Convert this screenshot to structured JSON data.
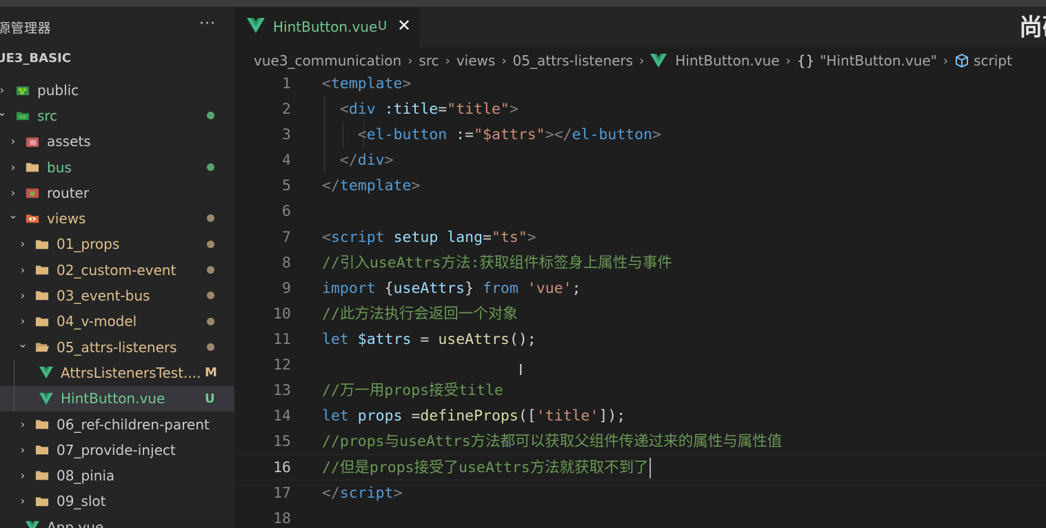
{
  "explorer": {
    "title": "源管理器",
    "more": "···",
    "project": "UE3_BASIC",
    "items": [
      {
        "label": "public",
        "chevron": "›",
        "icon": "public-folder-icon",
        "color": "#cccccc",
        "status": ""
      },
      {
        "label": "src",
        "chevron": "⌄",
        "icon": "src-folder-icon",
        "color": "#73c991",
        "status": "dot"
      },
      {
        "label": "assets",
        "chevron": "›",
        "icon": "assets-folder-icon",
        "color": "#cccccc",
        "status": ""
      },
      {
        "label": "bus",
        "chevron": "›",
        "icon": "folder-icon",
        "color": "#73c991",
        "status": "dot"
      },
      {
        "label": "router",
        "chevron": "›",
        "icon": "router-folder-icon",
        "color": "#cccccc",
        "status": ""
      },
      {
        "label": "views",
        "chevron": "⌄",
        "icon": "views-folder-icon",
        "color": "#e2c08d",
        "status": "dot"
      },
      {
        "label": "01_props",
        "chevron": "›",
        "icon": "folder-icon",
        "color": "#e2c08d",
        "status": "dot"
      },
      {
        "label": "02_custom-event",
        "chevron": "›",
        "icon": "folder-icon",
        "color": "#e2c08d",
        "status": "dot"
      },
      {
        "label": "03_event-bus",
        "chevron": "›",
        "icon": "folder-icon",
        "color": "#e2c08d",
        "status": "dot"
      },
      {
        "label": "04_v-model",
        "chevron": "›",
        "icon": "folder-icon",
        "color": "#e2c08d",
        "status": "dot"
      },
      {
        "label": "05_attrs-listeners",
        "chevron": "⌄",
        "icon": "open-folder-icon",
        "color": "#e2c08d",
        "status": "dot"
      },
      {
        "label": "AttrsListenersTest....",
        "chevron": "",
        "icon": "vue-file-icon",
        "color": "#e2c08d",
        "status": "M"
      },
      {
        "label": "HintButton.vue",
        "chevron": "",
        "icon": "vue-file-icon",
        "color": "#73c991",
        "status": "U"
      },
      {
        "label": "06_ref-children-parent",
        "chevron": "›",
        "icon": "folder-icon",
        "color": "#cccccc",
        "status": ""
      },
      {
        "label": "07_provide-inject",
        "chevron": "›",
        "icon": "folder-icon",
        "color": "#cccccc",
        "status": ""
      },
      {
        "label": "08_pinia",
        "chevron": "›",
        "icon": "folder-icon",
        "color": "#cccccc",
        "status": ""
      },
      {
        "label": "09_slot",
        "chevron": "›",
        "icon": "folder-icon",
        "color": "#cccccc",
        "status": ""
      },
      {
        "label": "App.vue",
        "chevron": "",
        "icon": "vue-file-icon",
        "color": "#cccccc",
        "status": ""
      }
    ]
  },
  "tab": {
    "name": "HintButton.vue",
    "flag": "U",
    "close": "✕"
  },
  "corner_text": "尚硅",
  "breadcrumb": {
    "items": [
      "vue3_communication",
      "src",
      "views",
      "05_attrs-listeners",
      "HintButton.vue",
      "\"HintButton.vue\"",
      "script"
    ],
    "braces": "{}"
  },
  "code": {
    "lines": [
      [
        [
          "tok-punct",
          "<"
        ],
        [
          "tok-tag",
          "template"
        ],
        [
          "tok-punct",
          ">"
        ]
      ],
      [
        [
          "",
          "  "
        ],
        [
          "tok-punct",
          "<"
        ],
        [
          "tok-tag",
          "div"
        ],
        [
          "tok-attr",
          " :title"
        ],
        [
          "",
          "="
        ],
        [
          "tok-str",
          "\"title\""
        ],
        [
          "tok-punct",
          ">"
        ]
      ],
      [
        [
          "",
          "    "
        ],
        [
          "tok-punct",
          "<"
        ],
        [
          "tok-tag",
          "el-button"
        ],
        [
          "tok-attr",
          " :"
        ],
        [
          "",
          "="
        ],
        [
          "tok-str",
          "\"$attrs\""
        ],
        [
          "tok-punct",
          "></"
        ],
        [
          "tok-tag",
          "el-button"
        ],
        [
          "tok-punct",
          ">"
        ]
      ],
      [
        [
          "",
          "  "
        ],
        [
          "tok-punct",
          "</"
        ],
        [
          "tok-tag",
          "div"
        ],
        [
          "tok-punct",
          ">"
        ]
      ],
      [
        [
          "tok-punct",
          "</"
        ],
        [
          "tok-tag",
          "template"
        ],
        [
          "tok-punct",
          ">"
        ]
      ],
      [
        [
          "",
          ""
        ]
      ],
      [
        [
          "tok-punct",
          "<"
        ],
        [
          "tok-tag",
          "script"
        ],
        [
          "tok-attr",
          " setup"
        ],
        [
          "tok-attr",
          " lang"
        ],
        [
          "",
          "="
        ],
        [
          "tok-str",
          "\"ts\""
        ],
        [
          "tok-punct",
          ">"
        ]
      ],
      [
        [
          "tok-com",
          "//引入useAttrs方法:获取组件标签身上属性与事件"
        ]
      ],
      [
        [
          "tok-kw",
          "import"
        ],
        [
          "",
          " {"
        ],
        [
          "tok-var",
          "useAttrs"
        ],
        [
          "",
          "} "
        ],
        [
          "tok-kw",
          "from"
        ],
        [
          "",
          " "
        ],
        [
          "tok-str",
          "'vue'"
        ],
        [
          "",
          ";"
        ]
      ],
      [
        [
          "tok-com",
          "//此方法执行会返回一个对象"
        ]
      ],
      [
        [
          "tok-kw",
          "let"
        ],
        [
          "",
          " "
        ],
        [
          "tok-var",
          "$attrs"
        ],
        [
          "",
          " = "
        ],
        [
          "tok-fn",
          "useAttrs"
        ],
        [
          "",
          "();"
        ]
      ],
      [
        [
          "",
          ""
        ]
      ],
      [
        [
          "tok-com",
          "//万一用props接受title"
        ]
      ],
      [
        [
          "tok-kw",
          "let"
        ],
        [
          "",
          " "
        ],
        [
          "tok-var",
          "props"
        ],
        [
          "",
          " ="
        ],
        [
          "tok-fn",
          "defineProps"
        ],
        [
          "",
          "(["
        ],
        [
          "tok-str",
          "'title'"
        ],
        [
          "",
          "]);"
        ]
      ],
      [
        [
          "tok-com",
          "//props与useAttrs方法都可以获取父组件传递过来的属性与属性值"
        ]
      ],
      [
        [
          "tok-com",
          "//但是props接受了useAttrs方法就获取不到了"
        ]
      ],
      [
        [
          "tok-punct",
          "</"
        ],
        [
          "tok-tag",
          "script"
        ],
        [
          "tok-punct",
          ">"
        ]
      ],
      [
        [
          "",
          ""
        ]
      ]
    ],
    "line_numbers": [
      "1",
      "2",
      "3",
      "4",
      "5",
      "6",
      "7",
      "8",
      "9",
      "10",
      "11",
      "12",
      "13",
      "14",
      "15",
      "16",
      "17",
      "18"
    ],
    "active_line": 16
  }
}
